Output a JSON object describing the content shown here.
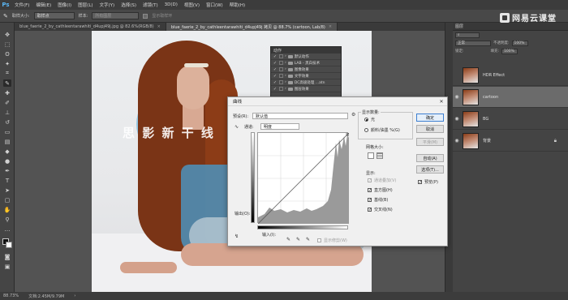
{
  "app": {
    "logo": "Ps"
  },
  "menu": {
    "items": [
      "文件(F)",
      "编辑(E)",
      "图像(I)",
      "图层(L)",
      "文字(Y)",
      "选择(S)",
      "滤镜(T)",
      "3D(D)",
      "视图(V)",
      "窗口(W)",
      "帮助(H)"
    ]
  },
  "options": {
    "sample_size_label": "取样大小:",
    "sample_size_value": "取样点",
    "sample_label": "样本:",
    "sample_value": "所有图层",
    "show_ring_label": "显示取样环"
  },
  "brand": {
    "text": "网易云课堂"
  },
  "tabs": [
    {
      "label": "blue_faerie_2_by_cathleentarawhiti_d4upj49j.jpg @ 82.6%(RGB/8)",
      "active": false
    },
    {
      "label": "blue_faerie_2_by_cathleentarawhiti_d4upj49j 拷贝 @ 88.7% (cartoon, Lab/8)",
      "active": true
    }
  ],
  "canvas": {
    "watermark": "思 影 新 干 线"
  },
  "status": {
    "zoom": "88.73%",
    "doc": "文档:2.45M/9.79M"
  },
  "actions_panel": {
    "title": "动作",
    "items": [
      "默认动作",
      "LAB - 黑白技术",
      "图像效果",
      "文字效果",
      "DC高级处理 ...atn",
      "图层效果"
    ]
  },
  "layers_panel": {
    "title": "图层",
    "mode": "正常",
    "opacity_label": "不透明度:",
    "opacity_value": "100%",
    "fill_label": "填充:",
    "fill_value": "100%",
    "lock_label": "锁定:",
    "layers": [
      {
        "name": "HDR Effect",
        "selected": false,
        "visible": false
      },
      {
        "name": "cartoon",
        "selected": true,
        "visible": true
      },
      {
        "name": "BG",
        "selected": false,
        "visible": true
      },
      {
        "name": "背景",
        "selected": false,
        "visible": true,
        "locked": true
      }
    ]
  },
  "curves": {
    "title": "曲线",
    "preset_label": "预设(R):",
    "preset_value": "默认值",
    "channel_label": "通道:",
    "channel_value": "明度",
    "output_label": "输出(O):",
    "input_label": "输入(I):",
    "show_clip_label": "显示修剪(W)",
    "show_amount_label": "显示数量:",
    "light_label": "光",
    "pigment_label": "颜料/油墨 %(G)",
    "grid_size_label": "网格大小:",
    "show_label": "显示:",
    "chk_channel_overlay": "通道叠加(V)",
    "chk_histogram": "直方图(H)",
    "chk_baseline": "基线(B)",
    "chk_intersection": "交叉线(N)",
    "btn_ok": "确定",
    "btn_cancel": "取消",
    "btn_smooth": "平滑(M)",
    "btn_auto": "自动(A)",
    "btn_options": "选项(T)...",
    "preview_label": "预览(P)"
  }
}
